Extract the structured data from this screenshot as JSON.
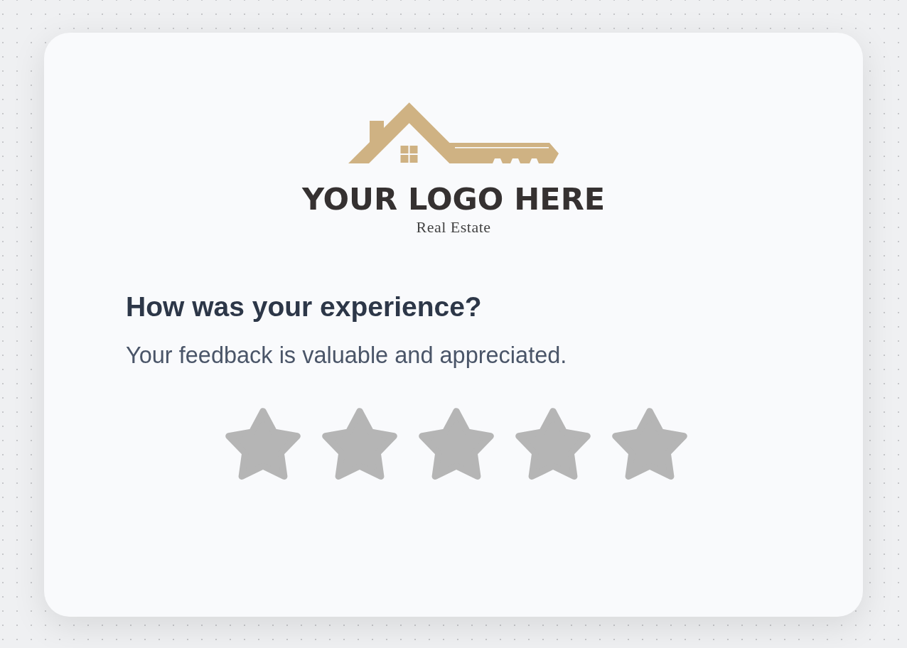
{
  "logo": {
    "name": "YOUR LOGO HERE",
    "tagline": "Real Estate"
  },
  "feedback": {
    "title": "How was your experience?",
    "subtitle": "Your feedback is valuable and appreciated.",
    "rating": {
      "stars": 0
    }
  }
}
